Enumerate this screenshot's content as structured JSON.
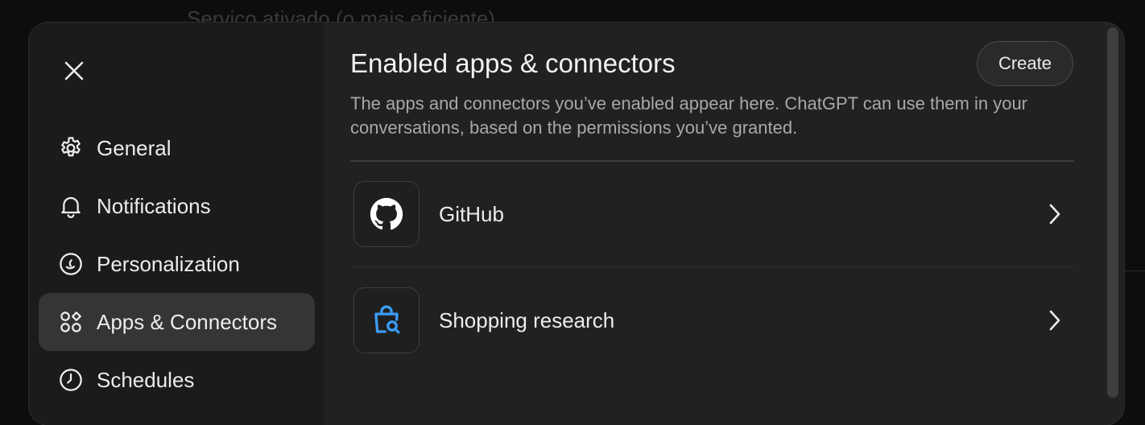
{
  "background": {
    "partial_text": "Serviço ativado (o mais eficiente)"
  },
  "sidebar": {
    "close_icon": "close-icon",
    "items": [
      {
        "label": "General",
        "icon": "gear-icon",
        "active": false
      },
      {
        "label": "Notifications",
        "icon": "bell-icon",
        "active": false
      },
      {
        "label": "Personalization",
        "icon": "personalization-icon",
        "active": false
      },
      {
        "label": "Apps & Connectors",
        "icon": "apps-icon",
        "active": true
      },
      {
        "label": "Schedules",
        "icon": "clock-icon",
        "active": false
      }
    ]
  },
  "main": {
    "title": "Enabled apps & connectors",
    "subtitle": "The apps and connectors you’ve enabled appear here. ChatGPT can use them in your conversations, based on the permissions you’ve granted.",
    "create_label": "Create",
    "apps": [
      {
        "label": "GitHub",
        "icon": "github-icon"
      },
      {
        "label": "Shopping research",
        "icon": "shopping-bag-search-icon"
      }
    ]
  },
  "colors": {
    "background": "#0d0d0d",
    "modal": "#212121",
    "sidebar": "#1b1b1b",
    "active_item": "#353535",
    "shopping_icon": "#3b9cf5"
  }
}
